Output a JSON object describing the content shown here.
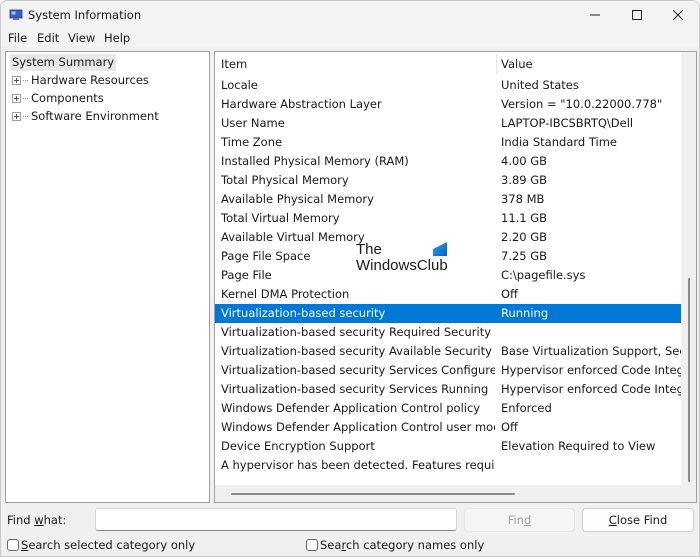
{
  "window": {
    "title": "System Information",
    "icon": "system-information-icon",
    "controls": {
      "minimize": "minimize-icon",
      "maximize": "maximize-icon",
      "close": "close-icon"
    }
  },
  "menubar": {
    "items": [
      "File",
      "Edit",
      "View",
      "Help"
    ]
  },
  "tree": {
    "root": "System Summary",
    "nodes": [
      "Hardware Resources",
      "Components",
      "Software Environment"
    ]
  },
  "list": {
    "headers": {
      "item": "Item",
      "value": "Value"
    },
    "rows": [
      {
        "item": "Locale",
        "value": "United States"
      },
      {
        "item": "Hardware Abstraction Layer",
        "value": "Version = \"10.0.22000.778\""
      },
      {
        "item": "User Name",
        "value": "LAPTOP-IBCSBRTQ\\Dell"
      },
      {
        "item": "Time Zone",
        "value": "India Standard Time"
      },
      {
        "item": "Installed Physical Memory (RAM)",
        "value": "4.00 GB"
      },
      {
        "item": "Total Physical Memory",
        "value": "3.89 GB"
      },
      {
        "item": "Available Physical Memory",
        "value": "378 MB"
      },
      {
        "item": "Total Virtual Memory",
        "value": "11.1 GB"
      },
      {
        "item": "Available Virtual Memory",
        "value": "2.20 GB"
      },
      {
        "item": "Page File Space",
        "value": "7.25 GB"
      },
      {
        "item": "Page File",
        "value": "C:\\pagefile.sys"
      },
      {
        "item": "Kernel DMA Protection",
        "value": "Off"
      },
      {
        "item": "Virtualization-based security",
        "value": "Running",
        "selected": true
      },
      {
        "item": "Virtualization-based security Required Security Pr...",
        "value": ""
      },
      {
        "item": "Virtualization-based security Available Security Pr...",
        "value": "Base Virtualization Support, Secur"
      },
      {
        "item": "Virtualization-based security Services Configured",
        "value": "Hypervisor enforced Code Integrit"
      },
      {
        "item": "Virtualization-based security Services Running",
        "value": "Hypervisor enforced Code Integrit"
      },
      {
        "item": "Windows Defender Application Control policy",
        "value": "Enforced"
      },
      {
        "item": "Windows Defender Application Control user mod...",
        "value": "Off"
      },
      {
        "item": "Device Encryption Support",
        "value": "Elevation Required to View"
      },
      {
        "item": "A hypervisor has been detected. Features require...",
        "value": ""
      }
    ]
  },
  "watermark": {
    "line1": "The",
    "line2": "WindowsClub"
  },
  "find": {
    "label_pre": "Find ",
    "label_accel": "w",
    "label_post": "hat:",
    "value": "",
    "placeholder": "",
    "find_button_pre": "Fin",
    "find_button_accel": "d",
    "close_button_accel": "C",
    "close_button_post": "lose Find",
    "checkbox1_accel": "S",
    "checkbox1_post": "earch selected category only",
    "checkbox1_checked": false,
    "checkbox2_pre": "Sea",
    "checkbox2_accel": "r",
    "checkbox2_post": "ch category names only",
    "checkbox2_checked": false
  },
  "colors": {
    "selection": "#0078d7",
    "window_bg": "#f0f0f0"
  }
}
